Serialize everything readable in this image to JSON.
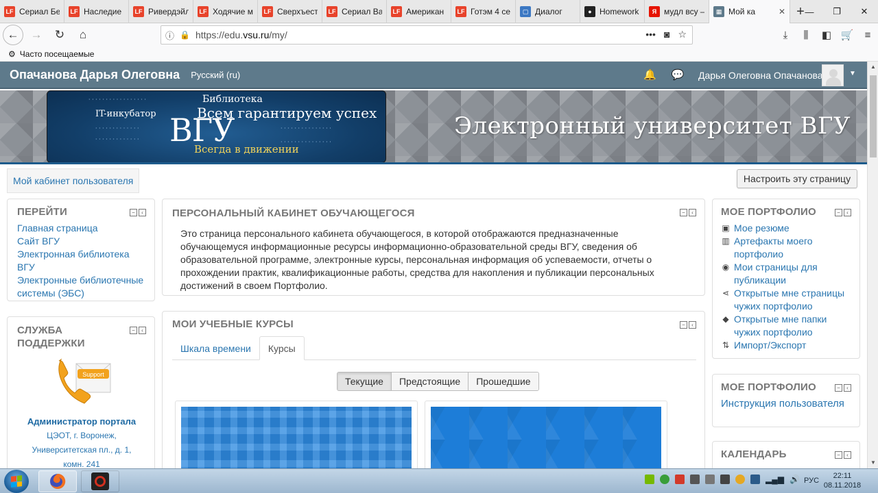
{
  "browser": {
    "tabs": [
      {
        "icon": "lf-icon",
        "color": "#e8432b",
        "title": "Сериал Бе"
      },
      {
        "icon": "lf-icon",
        "color": "#e8432b",
        "title": "Наследие"
      },
      {
        "icon": "lf-icon",
        "color": "#e8432b",
        "title": "Ривердэйл"
      },
      {
        "icon": "lf-icon",
        "color": "#e8432b",
        "title": "Ходячие м"
      },
      {
        "icon": "lf-icon",
        "color": "#e8432b",
        "title": "Сверхъест"
      },
      {
        "icon": "lf-icon",
        "color": "#e8432b",
        "title": "Сериал Ва"
      },
      {
        "icon": "lf-icon",
        "color": "#e8432b",
        "title": "Американ"
      },
      {
        "icon": "lf-icon",
        "color": "#e8432b",
        "title": "Готэм 4 се"
      },
      {
        "icon": "chat-icon",
        "color": "#3c78c3",
        "title": "Диалог"
      },
      {
        "icon": "github-icon",
        "color": "#222222",
        "title": "Homework"
      },
      {
        "icon": "yandex-icon",
        "color": "#e61400",
        "title": "мудл всу –"
      },
      {
        "icon": "moodle-icon",
        "color": "#5e7a8b",
        "title": "Мой ка"
      }
    ],
    "url_prefix": "https://edu.",
    "url_host": "vsu.ru",
    "url_path": "/my/",
    "bookmark_label": "Часто посещаемые"
  },
  "site": {
    "brand": "Опачанова Дарья Олеговна",
    "language": "Русский (ru)",
    "user_name": "Дарья Олеговна Опачанова",
    "banner_headline": "Электронный университет ВГУ",
    "logo_words": {
      "main": "ВГУ",
      "slogan1": "Всем гарантируем успех",
      "slogan2": "Всегда в движении",
      "incubator": "IT-инкубатор",
      "library": "Библиотека"
    }
  },
  "breadcrumb": "Мой кабинет пользователя",
  "customize_button": "Настроить эту страницу",
  "nav_block": {
    "title": "ПЕРЕЙТИ",
    "links": [
      "Главная страница",
      "Сайт ВГУ",
      "Электронная библиотека ВГУ",
      "Электронные библиотечные системы (ЭБС)"
    ]
  },
  "support_block": {
    "title": "СЛУЖБА ПОДДЕРЖКИ",
    "image_label": "Support",
    "admin": "Администратор портала",
    "org": "ЦЭОТ, г. Воронеж,",
    "address": "Университетская пл., д. 1,",
    "room": "комн. 241"
  },
  "intro_block": {
    "title": "ПЕРСОНАЛЬНЫЙ КАБИНЕТ ОБУЧАЮЩЕГОСЯ",
    "text": "Это страница персонального кабинета обучающегося, в которой отображаются предназначенные обучающемуся информационные ресурсы информационно-образовательной среды ВГУ, сведения об образовательной программе, электронные курсы, персональная информация об успеваемости, отчеты о прохождении практик, квалификационные работы, средства для накопления и публикации персональных достижений в своем Портфолио."
  },
  "courses_block": {
    "title": "МОИ УЧЕБНЫЕ КУРСЫ",
    "tabs": [
      "Шкала времени",
      "Курсы"
    ],
    "filters": [
      "Текущие",
      "Предстоящие",
      "Прошедшие"
    ]
  },
  "portfolio_block": {
    "title": "МОЕ ПОРТФОЛИО",
    "items": [
      {
        "icon": "resume-icon",
        "label": "Мое резюме"
      },
      {
        "icon": "artifacts-icon",
        "label": "Артефакты моего портфолио"
      },
      {
        "icon": "eye-icon",
        "label": "Мои страницы для публикации"
      },
      {
        "icon": "share-icon",
        "label": "Открытые мне страницы чужих портфолио"
      },
      {
        "icon": "tags-icon",
        "label": "Открытые мне папки чужих портфолио"
      },
      {
        "icon": "import-export-icon",
        "label": "Импорт/Экспорт"
      }
    ]
  },
  "portfolio2_block": {
    "title": "МОЕ ПОРТФОЛИО",
    "link": "Инструкция пользователя"
  },
  "calendar_block": {
    "title": "КАЛЕНДАРЬ"
  },
  "taskbar": {
    "language": "РУС",
    "time": "22:11",
    "date": "08.11.2018"
  }
}
